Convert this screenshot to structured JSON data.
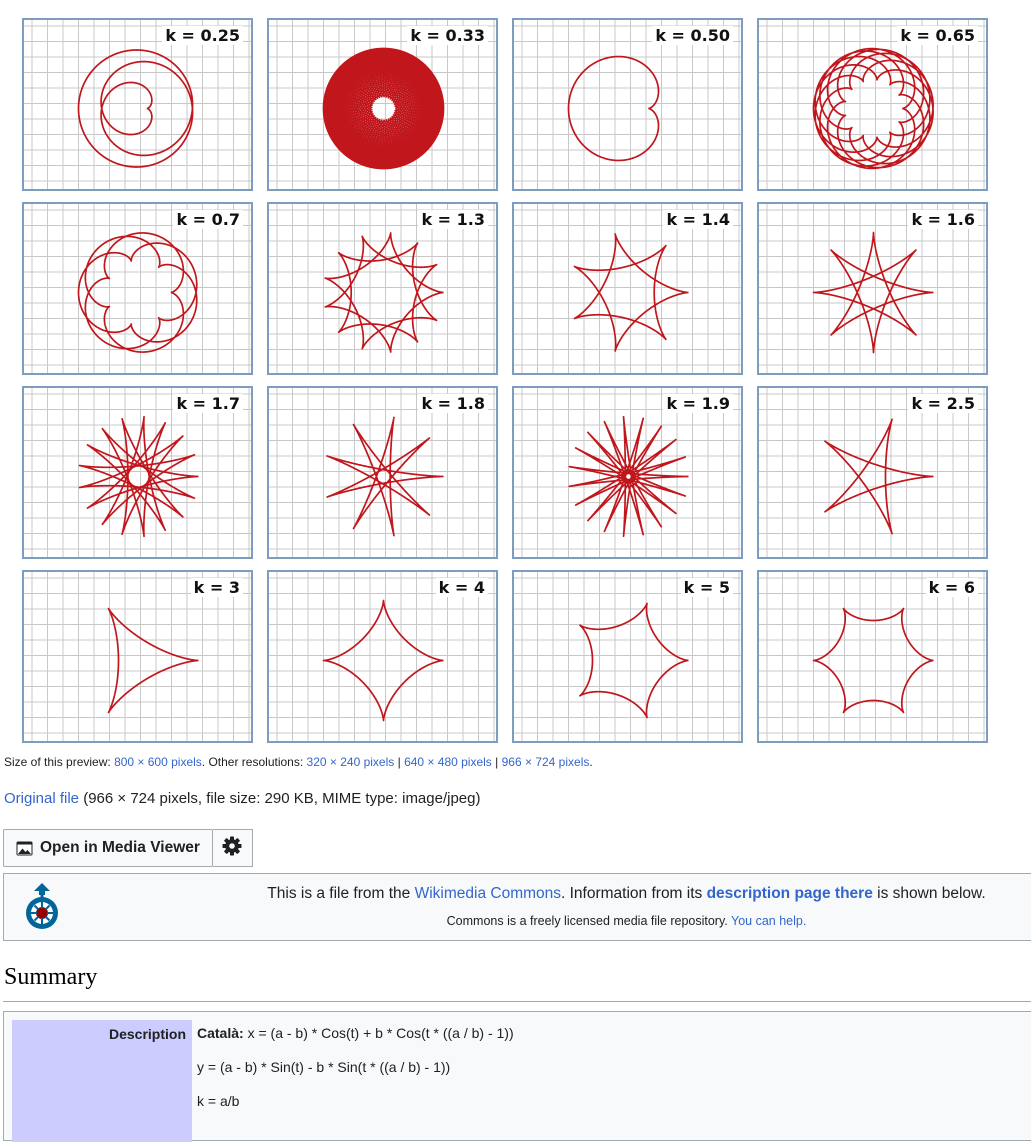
{
  "panels": [
    {
      "label": "k = 0.25",
      "k": 0.25
    },
    {
      "label": "k = 0.33",
      "k": 0.33
    },
    {
      "label": "k = 0.50",
      "k": 0.5
    },
    {
      "label": "k = 0.65",
      "k": 0.65
    },
    {
      "label": "k = 0.7",
      "k": 0.7
    },
    {
      "label": "k = 1.3",
      "k": 1.3
    },
    {
      "label": "k = 1.4",
      "k": 1.4
    },
    {
      "label": "k = 1.6",
      "k": 1.6
    },
    {
      "label": "k = 1.7",
      "k": 1.7
    },
    {
      "label": "k = 1.8",
      "k": 1.8
    },
    {
      "label": "k = 1.9",
      "k": 1.9
    },
    {
      "label": "k = 2.5",
      "k": 2.5
    },
    {
      "label": "k = 3",
      "k": 3
    },
    {
      "label": "k = 4",
      "k": 4
    },
    {
      "label": "k = 5",
      "k": 5
    },
    {
      "label": "k = 6",
      "k": 6
    }
  ],
  "colors": {
    "curve": "#c0161c",
    "grid": "#c8c8c8",
    "frame": "#7e9bc0",
    "link": "#3366cc",
    "desc_label_bg": "#ccccff"
  },
  "preview": {
    "prefix": "Size of this preview:",
    "size_link": "800 × 600 pixels",
    "middle": ". Other resolutions:",
    "res1": "320 × 240 pixels",
    "sep1": "|",
    "res2": "640 × 480 pixels",
    "sep2": "|",
    "res3": "966 × 724 pixels",
    "end": "."
  },
  "original": {
    "link": "Original file",
    "details": "(966 × 724 pixels, file size: 290 KB, MIME type: image/jpeg)"
  },
  "buttons": {
    "media_viewer": "Open in Media Viewer",
    "media_icon": "image-icon",
    "settings_icon": "gear-icon"
  },
  "commons": {
    "logo_icon": "commons-logo-icon",
    "t1": "This is a file from the",
    "link1": "Wikimedia Commons",
    "t2": ". Information from its",
    "link2": "description page there",
    "t3": "is shown below.",
    "t4": "Commons is a freely licensed media file repository.",
    "link3": "You can help."
  },
  "summary": {
    "heading": "Summary",
    "description_label": "Description",
    "lang": "Català:",
    "line1": "x = (a - b) * Cos(t) + b * Cos(t * ((a / b) - 1))",
    "line2": "y = (a - b) * Sin(t) - b * Sin(t * ((a / b) - 1))",
    "line3": "k = a/b"
  }
}
